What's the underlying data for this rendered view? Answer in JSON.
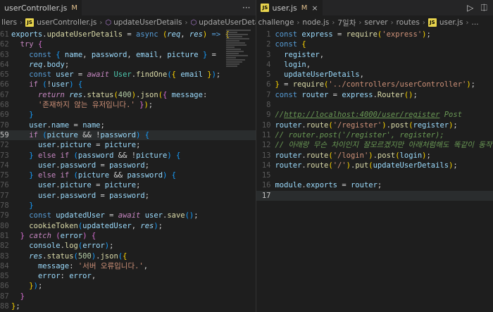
{
  "left": {
    "tabs": [
      {
        "label": "userController.js",
        "modified": "M"
      }
    ],
    "toolbar_more": "···",
    "breadcrumb": [
      "llers",
      "userController.js",
      "updateUserDetails",
      "updateUserDetails"
    ],
    "lines": [
      {
        "n": "61",
        "html": "<span class='var'>exports</span>.<span class='fn'>updateUserDetails</span> = <span class='kw'>async</span> <span class='br1'>(</span><span class='var it'>req</span>, <span class='var it'>res</span><span class='br1'>)</span> <span class='kw'>=&gt;</span> <span class='br1'>{</span>"
      },
      {
        "n": "62",
        "html": "  <span class='ctl'>try</span> <span class='br2'>{</span>"
      },
      {
        "n": "63",
        "html": "    <span class='kw'>const</span> <span class='br3'>{</span> <span class='var'>name</span>, <span class='var'>password</span>, <span class='var'>email</span>, <span class='var'>picture</span> <span class='br3'>}</span> ="
      },
      {
        "n": "64",
        "html": "    <span class='var it'>req</span>.<span class='var'>body</span>;"
      },
      {
        "n": "65",
        "html": "    <span class='kw'>const</span> <span class='var'>user</span> = <span class='ctl it'>await</span> <span class='cls'>User</span>.<span class='fn'>findOne</span><span class='br3'>(</span><span class='br1'>{</span> <span class='var'>email</span> <span class='br1'>}</span><span class='br3'>)</span>;"
      },
      {
        "n": "66",
        "html": "    <span class='ctl'>if</span> <span class='br3'>(</span>!<span class='var'>user</span><span class='br3'>)</span> <span class='br3'>{</span>"
      },
      {
        "n": "67",
        "html": "      <span class='ctl it'>return</span> <span class='var it'>res</span>.<span class='fn'>status</span><span class='br1'>(</span><span class='num'>400</span><span class='br1'>)</span>.<span class='fn'>json</span><span class='br1'>(</span><span class='br2'>{</span> <span class='var'>message</span>:"
      },
      {
        "n": "68",
        "html": "      <span class='str'>'존재하지 않는 유저입니다.'</span> <span class='br2'>}</span><span class='br1'>)</span>;"
      },
      {
        "n": "69",
        "html": "    <span class='br3'>}</span>"
      },
      {
        "n": "70",
        "html": "    <span class='var'>user</span>.<span class='var'>name</span> = <span class='var'>name</span>;"
      },
      {
        "n": "59",
        "html": "    <span class='ctl'>if</span> <span class='br3'>(</span><span class='var'>picture</span> &amp;&amp; !<span class='var'>password</span><span class='br3'>)</span> <span class='br3'>{</span>",
        "active": true
      },
      {
        "n": "72",
        "html": "      <span class='var'>user</span>.<span class='var'>picture</span> = <span class='var'>picture</span>;"
      },
      {
        "n": "73",
        "html": "    <span class='br3'>}</span> <span class='ctl'>else if</span> <span class='br3'>(</span><span class='var'>password</span> &amp;&amp; !<span class='var'>picture</span><span class='br3'>)</span> <span class='br3'>{</span>"
      },
      {
        "n": "74",
        "html": "      <span class='var'>user</span>.<span class='var'>password</span> = <span class='var'>password</span>;"
      },
      {
        "n": "75",
        "html": "    <span class='br3'>}</span> <span class='ctl'>else if</span> <span class='br3'>(</span><span class='var'>picture</span> &amp;&amp; <span class='var'>password</span><span class='br3'>)</span> <span class='br3'>{</span>"
      },
      {
        "n": "76",
        "html": "      <span class='var'>user</span>.<span class='var'>picture</span> = <span class='var'>picture</span>;"
      },
      {
        "n": "77",
        "html": "      <span class='var'>user</span>.<span class='var'>password</span> = <span class='var'>password</span>;"
      },
      {
        "n": "78",
        "html": "    <span class='br3'>}</span>"
      },
      {
        "n": "79",
        "html": "    <span class='kw'>const</span> <span class='var'>updatedUser</span> = <span class='ctl it'>await</span> <span class='var'>user</span>.<span class='fn'>save</span><span class='br3'>()</span>;"
      },
      {
        "n": "80",
        "html": "    <span class='fn'>cookieToken</span><span class='br3'>(</span><span class='var'>updatedUser</span>, <span class='var it'>res</span><span class='br3'>)</span>;"
      },
      {
        "n": "81",
        "html": "  <span class='br2'>}</span> <span class='ctl it'>catch</span> <span class='br2'>(</span><span class='var'>error</span><span class='br2'>)</span> <span class='br2'>{</span>"
      },
      {
        "n": "82",
        "html": "    <span class='var'>console</span>.<span class='fn'>log</span><span class='br3'>(</span><span class='var'>error</span><span class='br3'>)</span>;"
      },
      {
        "n": "83",
        "html": "    <span class='var it'>res</span>.<span class='fn'>status</span><span class='br3'>(</span><span class='num'>500</span><span class='br3'>)</span>.<span class='fn'>json</span><span class='br3'>(</span><span class='br1'>{</span>"
      },
      {
        "n": "84",
        "html": "      <span class='var'>message</span>: <span class='str'>'서버 오류입니다.'</span>,"
      },
      {
        "n": "85",
        "html": "      <span class='var'>error</span>: <span class='var'>error</span>,"
      },
      {
        "n": "86",
        "html": "    <span class='br1'>}</span><span class='br3'>)</span>;"
      },
      {
        "n": "87",
        "html": "  <span class='br2'>}</span>"
      },
      {
        "n": "88",
        "html": "<span class='br1'>}</span>;"
      }
    ]
  },
  "right": {
    "tabs": [
      {
        "label": "user.js",
        "modified": "M",
        "close": "×"
      }
    ],
    "breadcrumb": [
      "challenge",
      "node.js",
      "7일차",
      "server",
      "routes",
      "user.js",
      "..."
    ],
    "lines": [
      {
        "n": "1",
        "html": "<span class='kw'>const</span> <span class='var'>express</span> = <span class='fn'>require</span><span class='br1'>(</span><span class='str'>'express'</span><span class='br1'>)</span>;"
      },
      {
        "n": "2",
        "html": "<span class='kw'>const</span> <span class='br1'>{</span>"
      },
      {
        "n": "3",
        "html": "  <span class='var'>register</span>,"
      },
      {
        "n": "4",
        "html": "  <span class='var'>login</span>,"
      },
      {
        "n": "5",
        "html": "  <span class='var'>updateUserDetails</span>,"
      },
      {
        "n": "6",
        "html": "<span class='br1'>}</span> = <span class='fn'>require</span><span class='br1'>(</span><span class='str'>'../controllers/userController'</span><span class='br1'>)</span>;"
      },
      {
        "n": "7",
        "html": "<span class='kw'>const</span> <span class='var'>router</span> = <span class='var'>express</span>.<span class='fn'>Router</span><span class='br1'>()</span>;"
      },
      {
        "n": "8",
        "html": ""
      },
      {
        "n": "9",
        "html": "<span class='cmt'>//</span><span class='url'>http://localhost:4000/user/register</span><span class='cmt'> Post</span>"
      },
      {
        "n": "10",
        "html": "<span class='var'>router</span>.<span class='fn'>route</span><span class='br1'>(</span><span class='str'>'/register'</span><span class='br1'>)</span>.<span class='fn'>post</span><span class='br1'>(</span><span class='var'>register</span><span class='br1'>)</span>;"
      },
      {
        "n": "11",
        "html": "<span class='cmt'>// router.post('/register', register);</span>"
      },
      {
        "n": "12",
        "html": "<span class='cmt'>// 아래랑 무슨 차이인지 잘모르겠지만 아래처럼해도 똑같이 동작함</span>"
      },
      {
        "n": "13",
        "html": "<span class='var'>router</span>.<span class='fn'>route</span><span class='br1'>(</span><span class='str'>'/login'</span><span class='br1'>)</span>.<span class='fn'>post</span><span class='br1'>(</span><span class='var'>login</span><span class='br1'>)</span>;"
      },
      {
        "n": "14",
        "html": "<span class='var'>router</span>.<span class='fn'>route</span><span class='br1'>(</span><span class='str'>'/'</span><span class='br1'>)</span>.<span class='fn'>put</span><span class='br1'>(</span><span class='var'>updateUserDetails</span><span class='br1'>)</span>;"
      },
      {
        "n": "15",
        "html": ""
      },
      {
        "n": "16",
        "html": "<span class='var'>module</span>.<span class='var'>exports</span> = <span class='var'>router</span>;"
      },
      {
        "n": "17",
        "html": "",
        "active": true
      }
    ]
  },
  "icons": {
    "run": "▷",
    "split": "⎅",
    "more": "···"
  }
}
